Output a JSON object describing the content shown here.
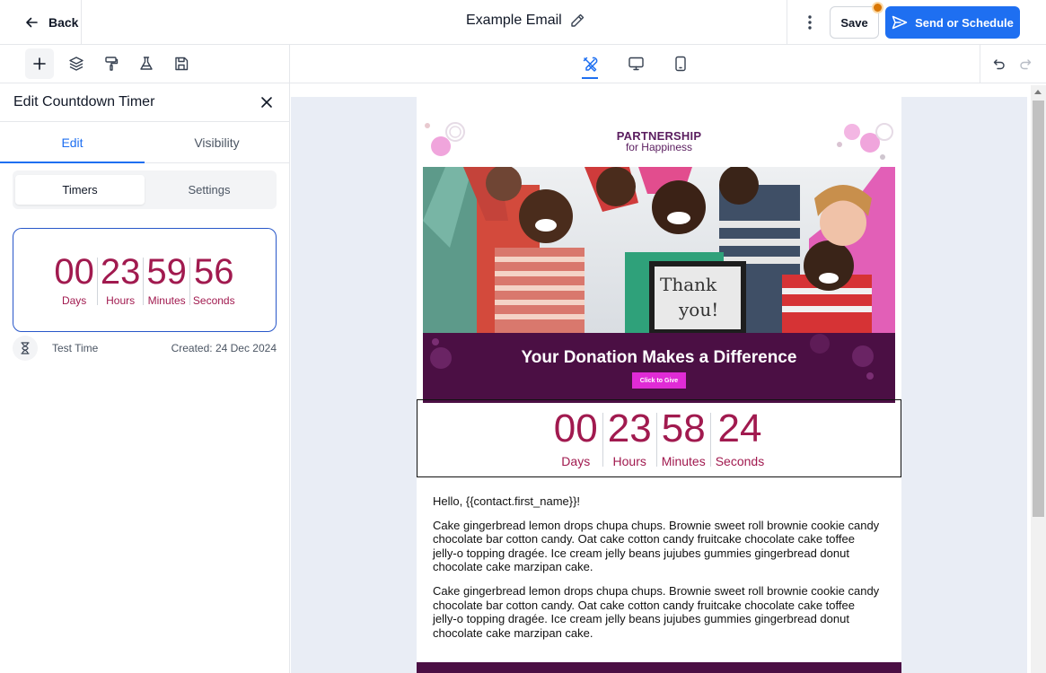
{
  "header": {
    "back_label": "Back",
    "email_title": "Example Email",
    "save_label": "Save",
    "send_label": "Send or Schedule"
  },
  "colors": {
    "primary": "#1e6ff1",
    "timer": "#a11a4f",
    "banner": "#4b0f44",
    "give_button": "#e02bd6",
    "notification_dot": "#d97706"
  },
  "toolbar": {
    "left_tools": [
      "plus-icon",
      "layers-icon",
      "paint-roller-icon",
      "flask-icon",
      "save-icon"
    ],
    "view_tools": [
      "tools-icon",
      "desktop-icon",
      "mobile-icon"
    ],
    "history": [
      "undo-icon",
      "redo-icon"
    ]
  },
  "panel": {
    "title": "Edit Countdown Timer",
    "tabs": [
      {
        "label": "Edit"
      },
      {
        "label": "Visibility"
      }
    ],
    "segments": [
      {
        "label": "Timers"
      },
      {
        "label": "Settings"
      }
    ],
    "timer": {
      "values": [
        "00",
        "23",
        "59",
        "56"
      ],
      "labels": [
        "Days",
        "Hours",
        "Minutes",
        "Seconds"
      ]
    },
    "timer_name": "Test Time",
    "timer_created": "Created: 24 Dec 2024"
  },
  "email": {
    "logo_line1": "PARTNERSHIP",
    "logo_line2": "for Happiness",
    "sign_text_1": "Thank",
    "sign_text_2": "you!",
    "banner_title": "Your Donation Makes a Difference",
    "give_button": "Click to Give",
    "timer": {
      "values": [
        "00",
        "23",
        "58",
        "24"
      ],
      "labels": [
        "Days",
        "Hours",
        "Minutes",
        "Seconds"
      ]
    },
    "greeting": "Hello,  {{contact.first_name}}!",
    "paragraphs": [
      "Cake gingerbread lemon drops chupa chups. Brownie sweet roll brownie cookie candy chocolate bar cotton candy. Oat cake cotton candy fruitcake chocolate cake toffee jelly-o topping dragée. Ice cream jelly beans jujubes gummies gingerbread donut chocolate cake marzipan cake.",
      "Cake gingerbread lemon drops chupa chups. Brownie sweet roll brownie cookie candy chocolate bar cotton candy. Oat cake cotton candy fruitcake chocolate cake toffee jelly-o topping dragée. Ice cream jelly beans jujubes gummies gingerbread donut chocolate cake marzipan cake."
    ]
  }
}
